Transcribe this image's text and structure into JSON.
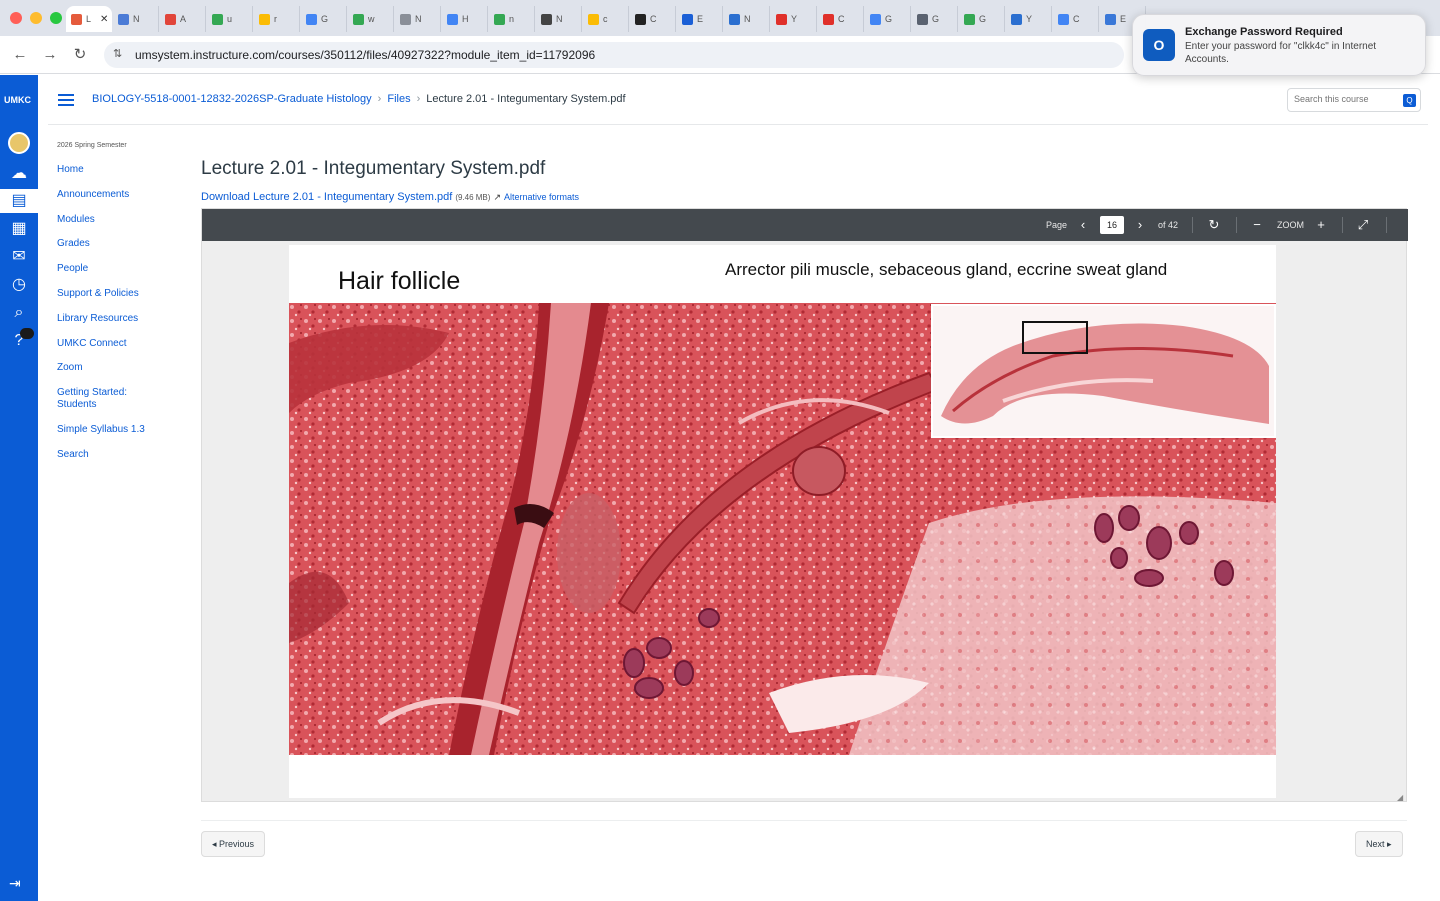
{
  "browser": {
    "tabs": [
      {
        "letter": "L",
        "favicon": "#e55b3c",
        "active": true
      },
      {
        "letter": "N",
        "favicon": "#4b7bd6"
      },
      {
        "letter": "A",
        "favicon": "#e1453a"
      },
      {
        "letter": "u",
        "favicon": "#34a853"
      },
      {
        "letter": "r",
        "favicon": "#fbbc05"
      },
      {
        "letter": "G",
        "favicon": "#4285f4"
      },
      {
        "letter": "w",
        "favicon": "#34a853"
      },
      {
        "letter": "N",
        "favicon": "#8a8f98"
      },
      {
        "letter": "H",
        "favicon": "#4285f4"
      },
      {
        "letter": "n",
        "favicon": "#34a853"
      },
      {
        "letter": "N",
        "favicon": "#444444"
      },
      {
        "letter": "c",
        "favicon": "#fbbc05"
      },
      {
        "letter": "C",
        "favicon": "#222222"
      },
      {
        "letter": "E",
        "favicon": "#1a5fd6"
      },
      {
        "letter": "N",
        "favicon": "#2b6fd0"
      },
      {
        "letter": "Y",
        "favicon": "#e0302a"
      },
      {
        "letter": "C",
        "favicon": "#e0302a"
      },
      {
        "letter": "G",
        "favicon": "#4285f4"
      },
      {
        "letter": "G",
        "favicon": "#5a6270"
      },
      {
        "letter": "G",
        "favicon": "#34a853"
      },
      {
        "letter": "Y",
        "favicon": "#2b6fd0"
      },
      {
        "letter": "C",
        "favicon": "#4285f4"
      },
      {
        "letter": "E",
        "favicon": "#3a78d8"
      }
    ],
    "url": "umsystem.instructure.com/courses/350112/files/40927322?module_item_id=11792096",
    "nav_icons": {
      "back": "←",
      "forward": "→",
      "reload": "↻",
      "site_info": "⇅"
    }
  },
  "notification": {
    "app_icon": "O",
    "title": "Exchange Password Required",
    "body": "Enter your password for \"clkk4c\" in Internet Accounts."
  },
  "global_nav": {
    "logo": "UMKC",
    "accent": "#0b5cd5"
  },
  "header": {
    "breadcrumb": {
      "course": "BIOLOGY-5518-0001-12832-2026SP-Graduate Histology",
      "files": "Files",
      "current": "Lecture 2.01 - Integumentary System.pdf",
      "separator": "›"
    },
    "search_placeholder": "Search this course",
    "search_button_icon": "Q"
  },
  "course_nav": {
    "term": "2026 Spring Semester",
    "items": [
      "Home",
      "Announcements",
      "Modules",
      "Grades",
      "People",
      "Support & Policies",
      "Library Resources",
      "UMKC Connect",
      "Zoom",
      "Getting Started: Students",
      "Simple Syllabus 1.3",
      "Search"
    ]
  },
  "file": {
    "title": "Lecture 2.01 - Integumentary System.pdf",
    "download_text": "Download Lecture 2.01 - Integumentary System.pdf",
    "size": "(9.46 MB)",
    "alt_icon": "↗",
    "alt_formats": "Alternative formats"
  },
  "viewer": {
    "page_label": "Page",
    "page_number": "16",
    "page_total": "of 42",
    "zoom_label": "ZOOM",
    "prev_icon": "‹",
    "next_icon": "›",
    "rotate_icon": "↻",
    "zoom_out_icon": "−",
    "zoom_in_icon": "+",
    "fullscreen_icon": "⤢",
    "toolbar_color": "#44494e"
  },
  "slide": {
    "title": "Hair follicle",
    "subtitle": "Arrector pili muscle, sebaceous gland, eccrine sweat gland",
    "tissue_color": "#c8323c"
  },
  "pager": {
    "previous": "◂ Previous",
    "next": "Next ▸"
  }
}
